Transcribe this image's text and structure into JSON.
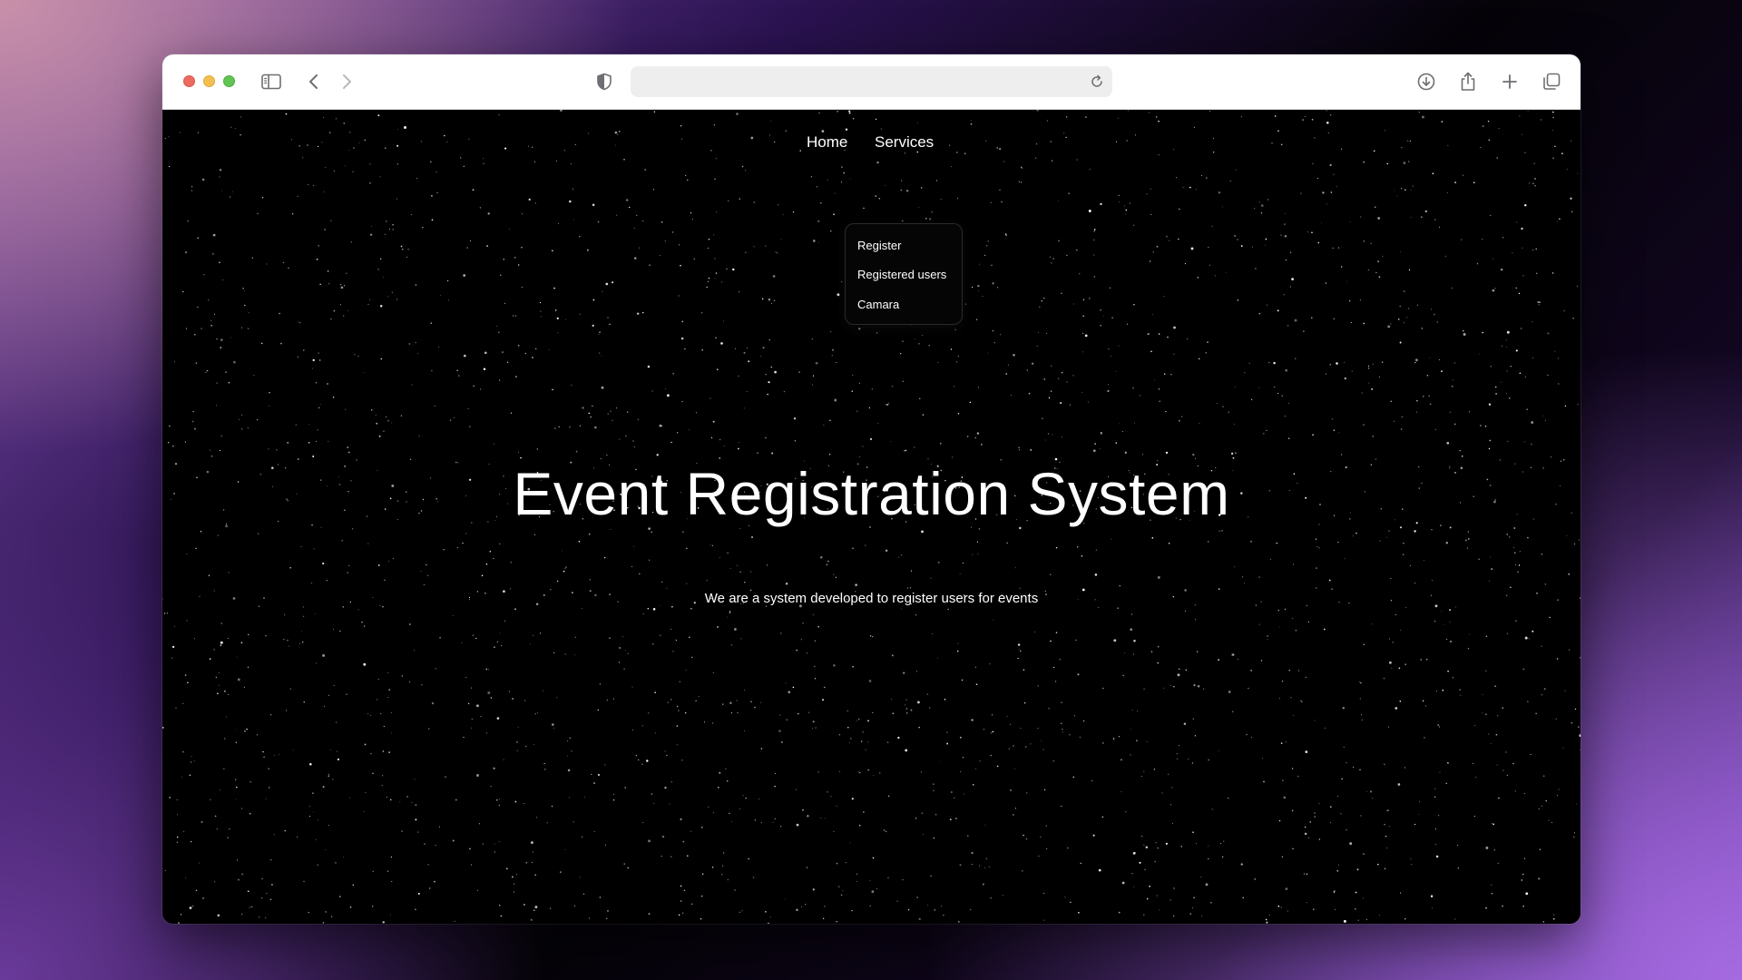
{
  "browser": {
    "address_placeholder": "",
    "icons": {
      "sidebar": "sidebar-icon",
      "back": "chevron-left-icon",
      "forward": "chevron-right-icon",
      "privacy": "shield-icon",
      "reload": "reload-icon",
      "download": "download-icon",
      "share": "share-icon",
      "new_tab": "plus-icon",
      "tabs": "tab-overview-icon"
    }
  },
  "nav": {
    "home_label": "Home",
    "services_label": "Services"
  },
  "services_menu": {
    "items": [
      {
        "label": "Register"
      },
      {
        "label": "Registered users"
      },
      {
        "label": "Camara"
      }
    ]
  },
  "hero": {
    "title": "Event Registration System",
    "subtitle": "We are a system developed to register users for events"
  },
  "colors": {
    "page_background": "#000000",
    "text": "#ffffff",
    "close": "#ed6a5e",
    "minimize": "#f5bf4f",
    "maximize": "#61c554"
  }
}
